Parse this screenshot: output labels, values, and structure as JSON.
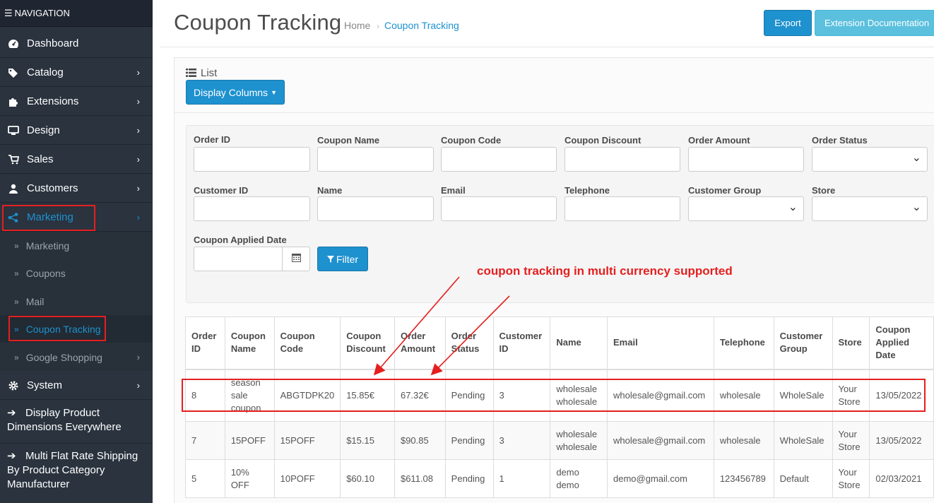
{
  "sidebar": {
    "header": "NAVIGATION",
    "items": [
      {
        "label": "Dashboard",
        "icon": "dashboard-icon"
      },
      {
        "label": "Catalog",
        "icon": "tags-icon"
      },
      {
        "label": "Extensions",
        "icon": "puzzle-icon"
      },
      {
        "label": "Design",
        "icon": "desktop-icon"
      },
      {
        "label": "Sales",
        "icon": "cart-icon"
      },
      {
        "label": "Customers",
        "icon": "user-icon"
      },
      {
        "label": "Marketing",
        "icon": "share-icon"
      }
    ],
    "subitems": [
      "Marketing",
      "Coupons",
      "Mail",
      "Coupon Tracking",
      "Google Shopping"
    ],
    "system": "System",
    "extra": [
      "Display Product Dimensions Everywhere",
      "Multi Flat Rate Shipping By Product Category Manufacturer"
    ]
  },
  "header": {
    "title": "Coupon Tracking",
    "breadcrumb_home": "Home",
    "breadcrumb_sep": "›",
    "breadcrumb_current": "Coupon Tracking",
    "export_label": "Export",
    "doc_label": "Extension Documentation"
  },
  "panel": {
    "title": "List",
    "display_columns_label": "Display Columns"
  },
  "filters": {
    "labels": [
      "Order ID",
      "Coupon Name",
      "Coupon Code",
      "Coupon Discount",
      "Order Amount",
      "Order Status",
      "Customer ID",
      "Name",
      "Email",
      "Telephone",
      "Customer Group",
      "Store",
      "Coupon Applied Date"
    ],
    "filter_button": "Filter"
  },
  "annotation": "coupon tracking in multi currency supported",
  "table": {
    "headers": [
      "Order ID",
      "Coupon Name",
      "Coupon Code",
      "Coupon Discount",
      "Order Amount",
      "Order Status",
      "Customer ID",
      "Name",
      "Email",
      "Telephone",
      "Customer Group",
      "Store",
      "Coupon Applied Date"
    ],
    "rows": [
      [
        "8",
        "season sale coupon",
        "ABGTDPK20",
        "15.85€",
        "67.32€",
        "Pending",
        "3",
        "wholesale wholesale",
        "wholesale@gmail.com",
        "wholesale",
        "WholeSale",
        "Your Store",
        "13/05/2022"
      ],
      [
        "7",
        "15POFF",
        "15POFF",
        "$15.15",
        "$90.85",
        "Pending",
        "3",
        "wholesale wholesale",
        "wholesale@gmail.com",
        "wholesale",
        "WholeSale",
        "Your Store",
        "13/05/2022"
      ],
      [
        "5",
        "10% OFF",
        "10POFF",
        "$60.10",
        "$611.08",
        "Pending",
        "1",
        "demo demo",
        "demo@gmail.com",
        "123456789",
        "Default",
        "Your Store",
        "02/03/2021"
      ]
    ]
  },
  "colors": {
    "accent": "#1e91cf",
    "sidebar_bg": "#2a333e",
    "annotation_red": "#e51f1f"
  }
}
